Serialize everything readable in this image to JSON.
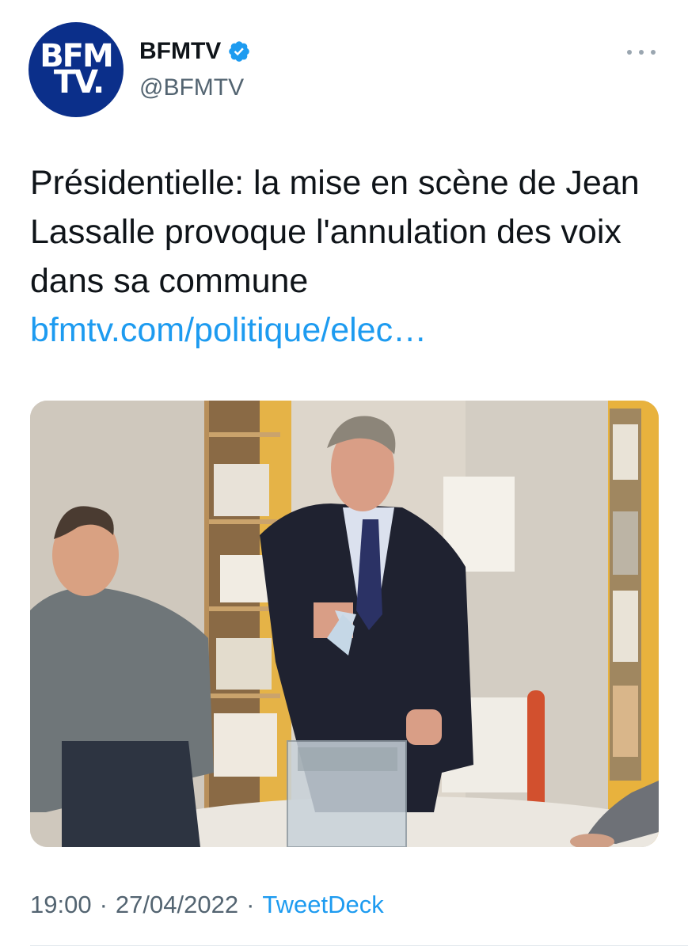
{
  "account": {
    "avatar_line1": "BFM",
    "avatar_line2": "TV.",
    "name": "BFMTV",
    "handle": "@BFMTV",
    "verified": true
  },
  "tweet": {
    "text": "Présidentielle: la mise en scène de Jean Lassalle provoque l'annulation des voix dans sa commune",
    "link": "bfmtv.com/politique/elec…",
    "time": "19:00",
    "separator": "·",
    "date": "27/04/2022",
    "source": "TweetDeck"
  },
  "icons": {
    "verified": "verified-badge-icon",
    "more": "more-options-icon"
  },
  "colors": {
    "link": "#1d9bf0",
    "avatar_bg": "#0b2f8a",
    "secondary_text": "#536471"
  }
}
